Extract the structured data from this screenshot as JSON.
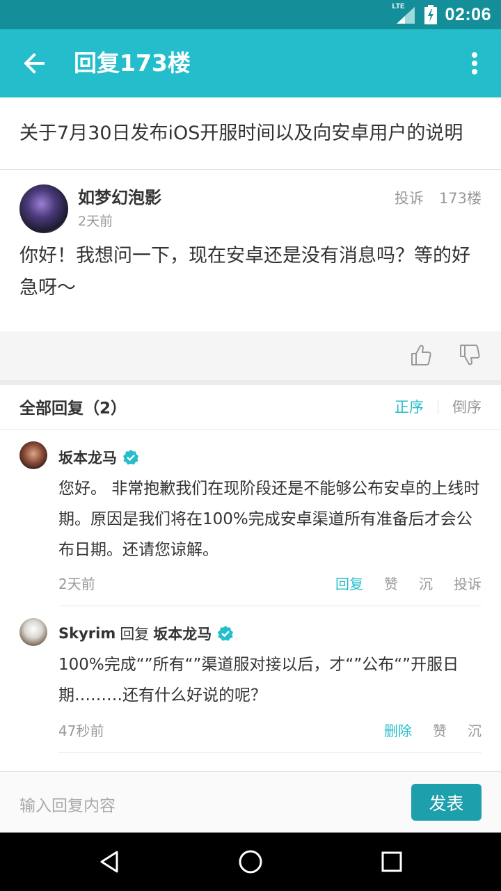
{
  "status_bar": {
    "time": "02:06",
    "network": "LTE",
    "icons": [
      "lte-signal-icon",
      "battery-icon"
    ]
  },
  "app_bar": {
    "title": "回复173楼",
    "icons": [
      "back-arrow-icon",
      "more-vert-icon"
    ]
  },
  "thread": {
    "title": "关于7月30日发布iOS开服时间以及向安卓用户的说明"
  },
  "floor": {
    "username": "如梦幻泡影",
    "time": "2天前",
    "report_label": "投诉",
    "floor_label": "173楼",
    "content": "你好！我想问一下，现在安卓还是没有消息吗？等的好急呀～",
    "icons": [
      "thumb-up-icon",
      "thumb-down-icon"
    ]
  },
  "replies_header": {
    "label": "全部回复（2）",
    "sort_asc": "正序",
    "sort_desc": "倒序"
  },
  "replies": [
    {
      "username": "坂本龙马",
      "verified": true,
      "content": "您好。 非常抱歉我们在现阶段还是不能够公布安卓的上线时期。原因是我们将在100%完成安卓渠道所有准备后才会公布日期。还请您谅解。",
      "time": "2天前",
      "actions": [
        "回复",
        "赞",
        "沉",
        "投诉"
      ]
    },
    {
      "username": "Skyrim",
      "reply_word": "回复",
      "reply_to": "坂本龙马",
      "reply_to_verified": true,
      "content": "100%完成“”所有“”渠道服对接以后，才“”公布“”开服日期………还有什么好说的呢？",
      "time": "47秒前",
      "actions": [
        "删除",
        "赞",
        "沉"
      ]
    }
  ],
  "input": {
    "placeholder": "输入回复内容",
    "send_label": "发表"
  },
  "nav_bar": {
    "icons": [
      "back-triangle-icon",
      "home-circle-icon",
      "recents-square-icon"
    ]
  },
  "colors": {
    "status_bar": "#148f9a",
    "app_bar": "#23bdcb",
    "accent": "#23bdcb",
    "send_button": "#1e9fac"
  }
}
